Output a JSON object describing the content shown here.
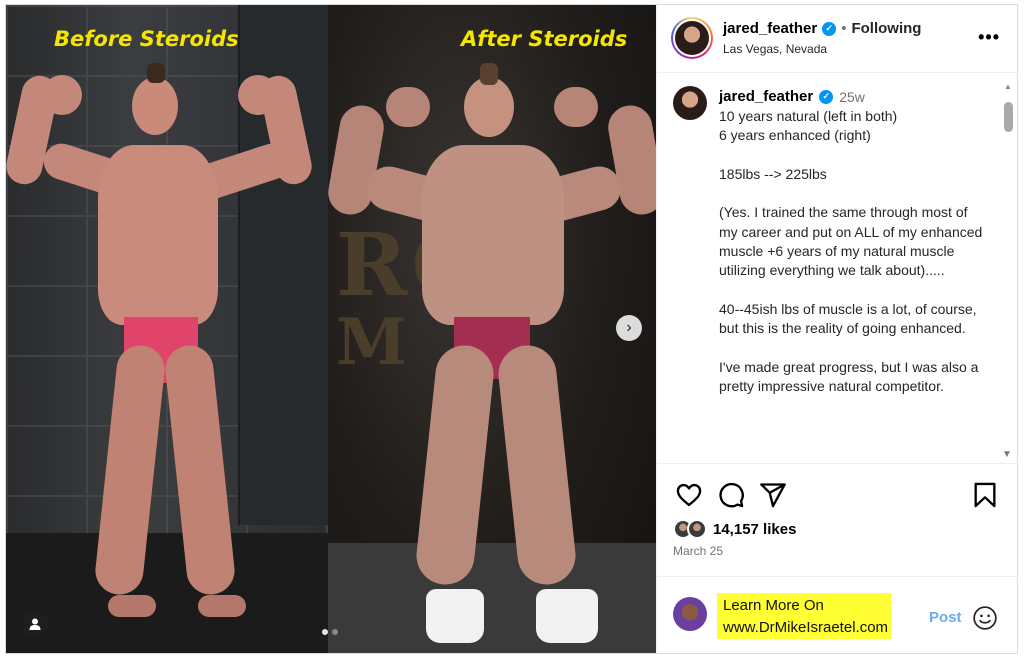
{
  "media": {
    "caption_left": "Before Steroids",
    "caption_right": "After Steroids",
    "carousel": {
      "count": 2,
      "active_index": 0
    }
  },
  "header": {
    "username": "jared_feather",
    "verified": true,
    "follow_status": "Following",
    "location": "Las Vegas, Nevada"
  },
  "caption_comment": {
    "username": "jared_feather",
    "time": "25w",
    "text": "10 years natural (left in both)\n6 years enhanced (right)\n\n185lbs --> 225lbs\n\n(Yes. I trained the same through most of my career and put on ALL of my enhanced muscle +6 years of my natural muscle utilizing everything we talk about).....\n\n40--45ish lbs of muscle is a lot, of course, but this is the reality of going enhanced.\n\nI've made great progress, but I was also a pretty impressive natural competitor."
  },
  "actions": {
    "icons": [
      "heart-icon",
      "comment-icon",
      "share-icon",
      "bookmark-icon"
    ]
  },
  "stats": {
    "likes": "14,157 likes",
    "date": "March 25"
  },
  "comment_box": {
    "line1": "Learn More On",
    "line2": "www.DrMikeIsraetel.com",
    "post_label": "Post"
  },
  "colors": {
    "caption_yellow": "#f5e600",
    "highlight_yellow": "#ffff33",
    "verified_blue": "#0095f6",
    "post_blue": "#6eaaf0"
  }
}
